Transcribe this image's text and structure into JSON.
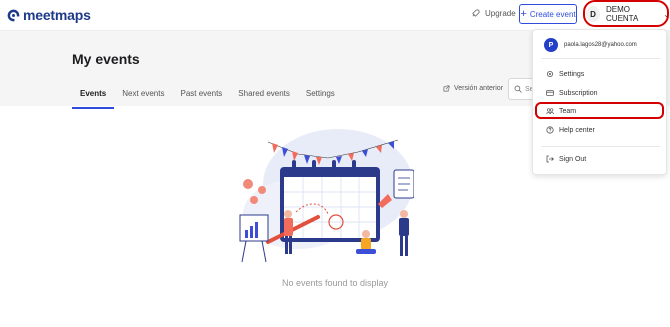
{
  "app": {
    "logo_text": "meetmaps",
    "brand_color": "#2f4cdd"
  },
  "topbar": {
    "upgrade_label": "Upgrade",
    "create_event_label": "Create event",
    "account_initial": "D",
    "account_name": "DEMO CUENTA"
  },
  "header": {
    "title": "My events",
    "tabs": [
      {
        "label": "Events",
        "active": true
      },
      {
        "label": "Next events",
        "active": false
      },
      {
        "label": "Past events",
        "active": false
      },
      {
        "label": "Shared events",
        "active": false
      },
      {
        "label": "Settings",
        "active": false
      }
    ],
    "version_link": "Versión anterior",
    "search_placeholder": "Se"
  },
  "main": {
    "empty_message": "No events found to display"
  },
  "account_menu": {
    "avatar_initial": "P",
    "email": "paola.lagos28@yahoo.com",
    "items": [
      {
        "label": "Settings",
        "icon": "gear-icon"
      },
      {
        "label": "Subscription",
        "icon": "card-icon"
      },
      {
        "label": "Team",
        "icon": "team-icon"
      },
      {
        "label": "Help center",
        "icon": "help-icon"
      },
      {
        "label": "Sign Out",
        "icon": "sign-out-icon"
      }
    ]
  },
  "annotation_color": "#d40000"
}
